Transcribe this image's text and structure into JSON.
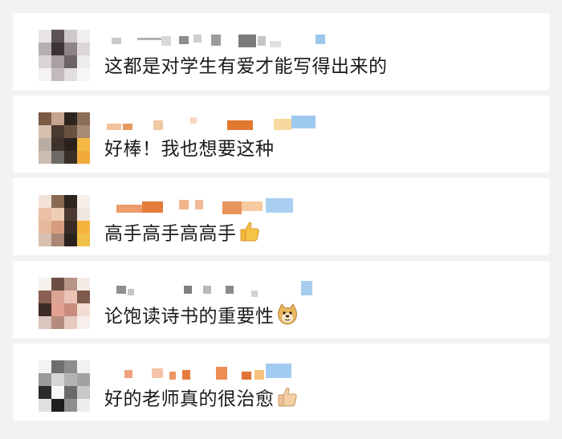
{
  "comments": [
    {
      "text": "这都是对学生有爱才能写得出来的",
      "emoji": ""
    },
    {
      "text": "好棒！我也想要这种",
      "emoji": ""
    },
    {
      "text": "高手高手高高手",
      "emoji": "thumbs-up"
    },
    {
      "text": "论饱读诗书的重要性",
      "emoji": "doge-face"
    },
    {
      "text": "好的老师真的很治愈",
      "emoji": "thumbs-up"
    }
  ]
}
